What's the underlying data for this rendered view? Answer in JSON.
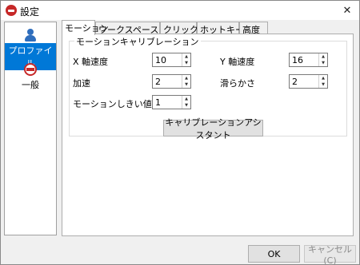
{
  "window": {
    "title": "設定",
    "close_glyph": "✕"
  },
  "sidebar": {
    "items": [
      {
        "label": "プロファイル",
        "icon": "profile-icon",
        "selected": true
      },
      {
        "label": "一般",
        "icon": "general-icon",
        "selected": false
      }
    ]
  },
  "tabs": [
    {
      "label": "モーション",
      "active": true
    },
    {
      "label": "ワークスペース",
      "active": false
    },
    {
      "label": "クリック",
      "active": false
    },
    {
      "label": "ホットキー",
      "active": false
    },
    {
      "label": "高度",
      "active": false
    }
  ],
  "motion": {
    "group_title": "モーションキャリブレーション",
    "x_speed": {
      "label": "X 軸速度",
      "value": "10"
    },
    "y_speed": {
      "label": "Y 軸速度",
      "value": "16"
    },
    "acceleration": {
      "label": "加速",
      "value": "2"
    },
    "smoothness": {
      "label": "滑らかさ",
      "value": "2"
    },
    "threshold": {
      "label": "モーションしきい値",
      "value": "1"
    },
    "assistant_button": "キャリブレーションアシスタント"
  },
  "footer": {
    "ok": "OK",
    "cancel": "キャンセル(C)"
  },
  "colors": {
    "selection": "#0078d7",
    "brand": "#c62828",
    "profile": "#2f6ebd"
  }
}
